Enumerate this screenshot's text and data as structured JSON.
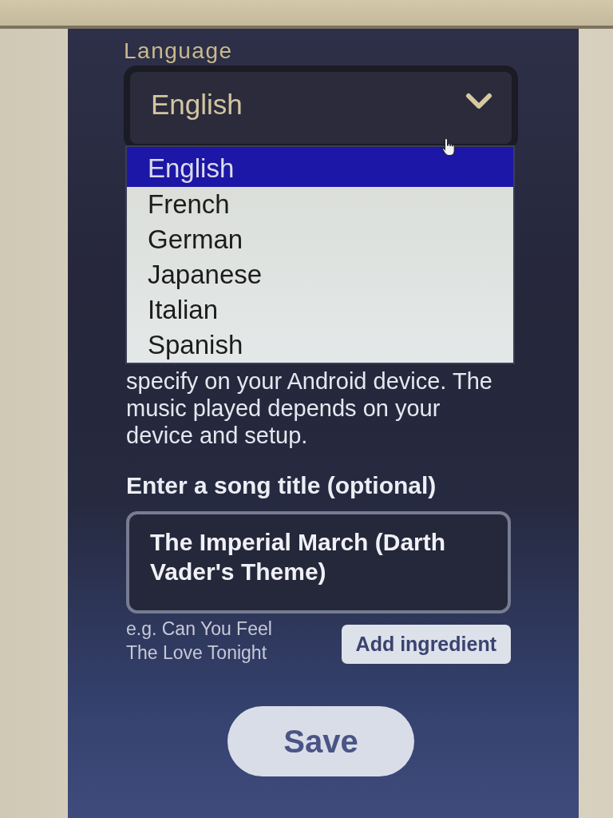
{
  "language": {
    "label": "Language",
    "value": "English",
    "expanded": true,
    "options": [
      {
        "label": "English",
        "selected": true
      },
      {
        "label": "French",
        "selected": false
      },
      {
        "label": "German",
        "selected": false
      },
      {
        "label": "Japanese",
        "selected": false
      },
      {
        "label": "Italian",
        "selected": false
      },
      {
        "label": "Spanish",
        "selected": false
      }
    ]
  },
  "description": "specify on your Android device. The music played depends on your device and setup.",
  "song_title": {
    "label": "Enter a song title (optional)",
    "value": "The Imperial March (Darth Vader's Theme)",
    "hint": "e.g. Can You Feel The Love Tonight",
    "add_button": "Add ingredient"
  },
  "save_button": "Save"
}
